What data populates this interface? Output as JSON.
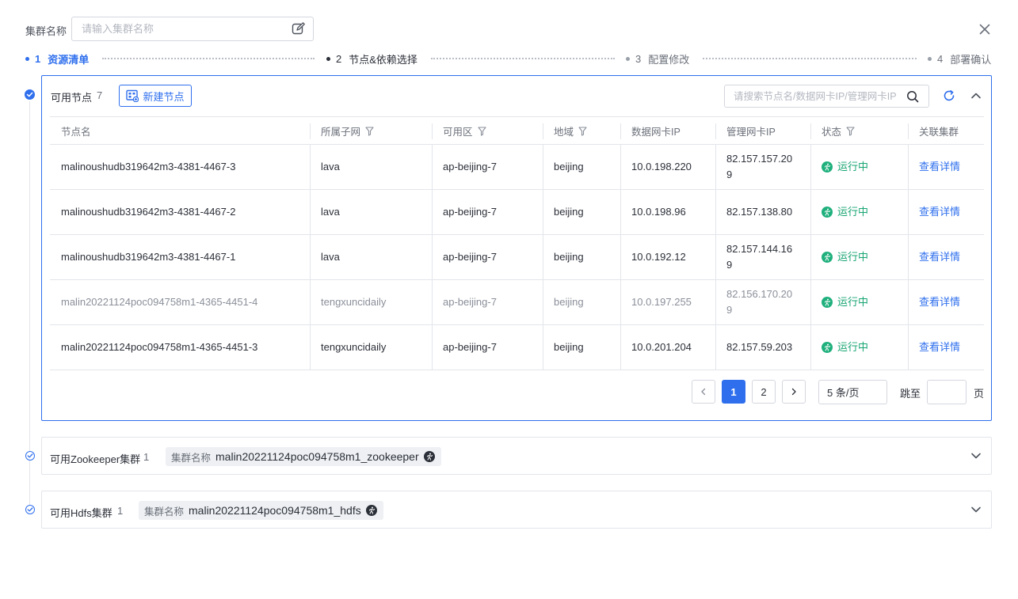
{
  "form": {
    "cluster_name_label": "集群名称",
    "cluster_name_placeholder": "请输入集群名称",
    "cluster_name_value": ""
  },
  "steps": [
    {
      "num": "1",
      "label": "资源清单",
      "state": "active"
    },
    {
      "num": "2",
      "label": "节点&依赖选择",
      "state": "current"
    },
    {
      "num": "3",
      "label": "配置修改",
      "state": "pending"
    },
    {
      "num": "4",
      "label": "部署确认",
      "state": "pending"
    }
  ],
  "nodes_panel": {
    "title": "可用节点",
    "count": "7",
    "new_button": "新建节点",
    "search_placeholder": "请搜索节点名/数据网卡IP/管理网卡IP",
    "columns": [
      "节点名",
      "所属子网",
      "可用区",
      "地域",
      "数据网卡IP",
      "管理网卡IP",
      "状态",
      "关联集群"
    ],
    "rows": [
      {
        "name": "malinoushudb319642m3-4381-4467-3",
        "subnet": "lava",
        "zone": "ap-beijing-7",
        "region": "beijing",
        "data_ip": "10.0.198.220",
        "mgmt_ip": "82.157.157.209",
        "status": "运行中",
        "cluster_link": "查看详情",
        "muted": false
      },
      {
        "name": "malinoushudb319642m3-4381-4467-2",
        "subnet": "lava",
        "zone": "ap-beijing-7",
        "region": "beijing",
        "data_ip": "10.0.198.96",
        "mgmt_ip": "82.157.138.80",
        "status": "运行中",
        "cluster_link": "查看详情",
        "muted": false
      },
      {
        "name": "malinoushudb319642m3-4381-4467-1",
        "subnet": "lava",
        "zone": "ap-beijing-7",
        "region": "beijing",
        "data_ip": "10.0.192.12",
        "mgmt_ip": "82.157.144.169",
        "status": "运行中",
        "cluster_link": "查看详情",
        "muted": false
      },
      {
        "name": "malin20221124poc094758m1-4365-4451-4",
        "subnet": "tengxuncidaily",
        "zone": "ap-beijing-7",
        "region": "beijing",
        "data_ip": "10.0.197.255",
        "mgmt_ip": "82.156.170.209",
        "status": "运行中",
        "cluster_link": "查看详情",
        "muted": true
      },
      {
        "name": "malin20221124poc094758m1-4365-4451-3",
        "subnet": "tengxuncidaily",
        "zone": "ap-beijing-7",
        "region": "beijing",
        "data_ip": "10.0.201.204",
        "mgmt_ip": "82.157.59.203",
        "status": "运行中",
        "cluster_link": "查看详情",
        "muted": false
      }
    ],
    "pagination": {
      "pages": [
        "1",
        "2"
      ],
      "current": "1",
      "page_size": "5 条/页",
      "jump_label": "跳至",
      "page_suffix": "页"
    }
  },
  "zookeeper_panel": {
    "title": "可用Zookeeper集群",
    "count": "1",
    "tag_key": "集群名称",
    "tag_value": "malin20221124poc094758m1_zookeeper"
  },
  "hdfs_panel": {
    "title": "可用Hdfs集群",
    "count": "1",
    "tag_key": "集群名称",
    "tag_value": "malin20221124poc094758m1_hdfs"
  },
  "colors": {
    "primary": "#2f6fed",
    "running": "#17a572",
    "border": "#e3e5ea"
  }
}
